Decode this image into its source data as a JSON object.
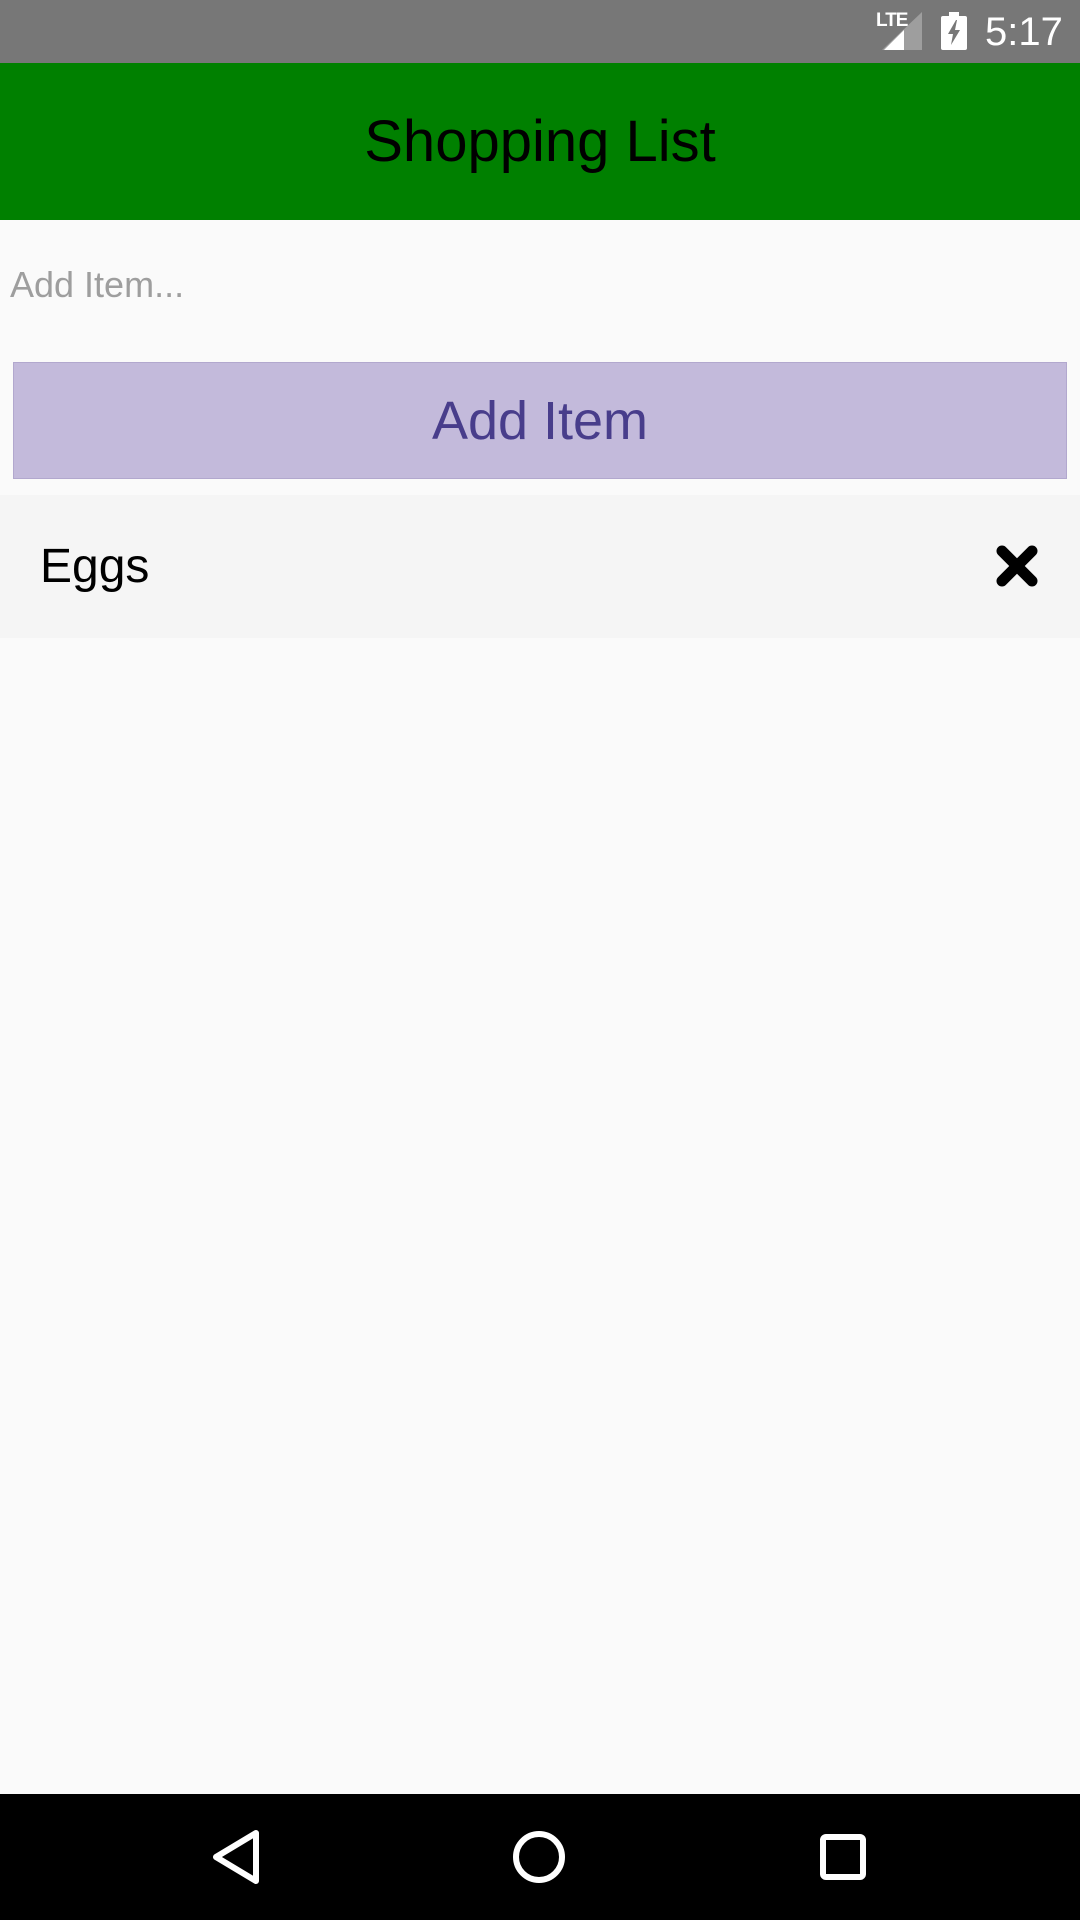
{
  "status_bar": {
    "network": "LTE",
    "time": "5:17",
    "icons": [
      "lte-signal-icon",
      "battery-charging-icon"
    ]
  },
  "app_bar": {
    "title": "Shopping List",
    "background": "#008000"
  },
  "add_item": {
    "input_value": "",
    "placeholder": "Add Item...",
    "button_label": "Add Item",
    "button_color": "#C3BADB",
    "button_text_color": "#483D8B"
  },
  "items": [
    {
      "name": "Eggs",
      "delete_icon": "close-icon"
    }
  ],
  "nav_bar": {
    "buttons": [
      "back-icon",
      "home-icon",
      "recents-icon"
    ]
  }
}
